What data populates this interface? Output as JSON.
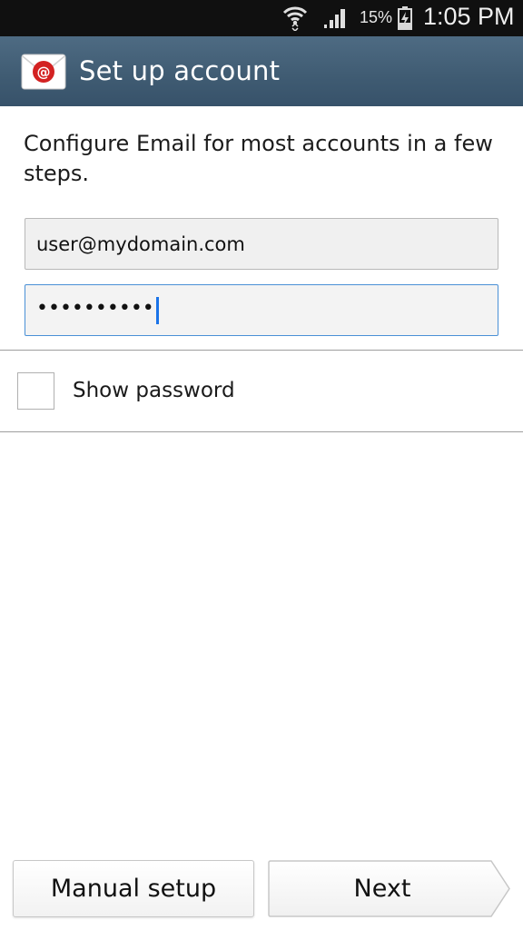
{
  "status_bar": {
    "battery_percent": "15%",
    "time": "1:05 PM",
    "icons": [
      "wifi-icon",
      "signal-icon",
      "battery-charging-icon"
    ]
  },
  "action_bar": {
    "title": "Set up account",
    "icon": "email-app-icon"
  },
  "intro_text": "Configure Email for most accounts in a few steps.",
  "form": {
    "email_value": "user@mydomain.com",
    "password_masked": "••••••••••",
    "password_focused": true
  },
  "show_password": {
    "label": "Show password",
    "checked": false
  },
  "buttons": {
    "manual_setup": "Manual setup",
    "next": "Next"
  },
  "colors": {
    "action_bar": "#3f5b72",
    "focus_border": "#4a90d6",
    "cursor": "#1a73e8"
  }
}
